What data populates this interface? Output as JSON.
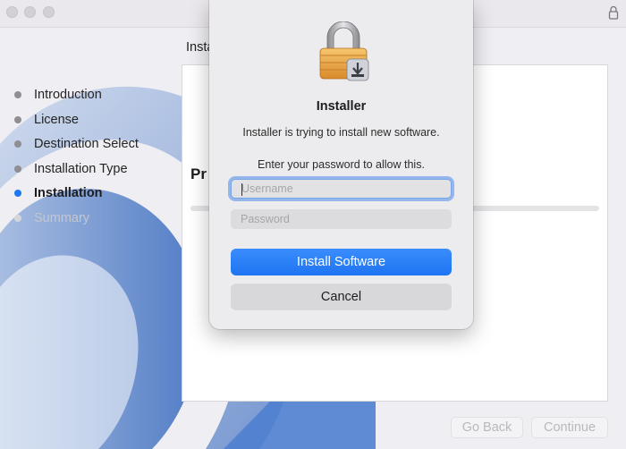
{
  "window": {
    "pane_title": "Insta",
    "progress_title": "Pr",
    "lock_icon": "lock-icon"
  },
  "sidebar": {
    "steps": [
      {
        "label": "Introduction",
        "state": "done"
      },
      {
        "label": "License",
        "state": "done"
      },
      {
        "label": "Destination Select",
        "state": "done"
      },
      {
        "label": "Installation Type",
        "state": "done"
      },
      {
        "label": "Installation",
        "state": "active"
      },
      {
        "label": "Summary",
        "state": "pending"
      }
    ]
  },
  "footer": {
    "back_label": "Go Back",
    "continue_label": "Continue"
  },
  "dialog": {
    "icon": "padlock-installer-icon",
    "title": "Installer",
    "message": "Installer is trying to install new software.",
    "prompt": "Enter your password to allow this.",
    "username_placeholder": "Username",
    "password_placeholder": "Password",
    "install_label": "Install Software",
    "cancel_label": "Cancel"
  },
  "colors": {
    "accent": "#1e78f0",
    "primary_button": "#2a7ff6"
  }
}
